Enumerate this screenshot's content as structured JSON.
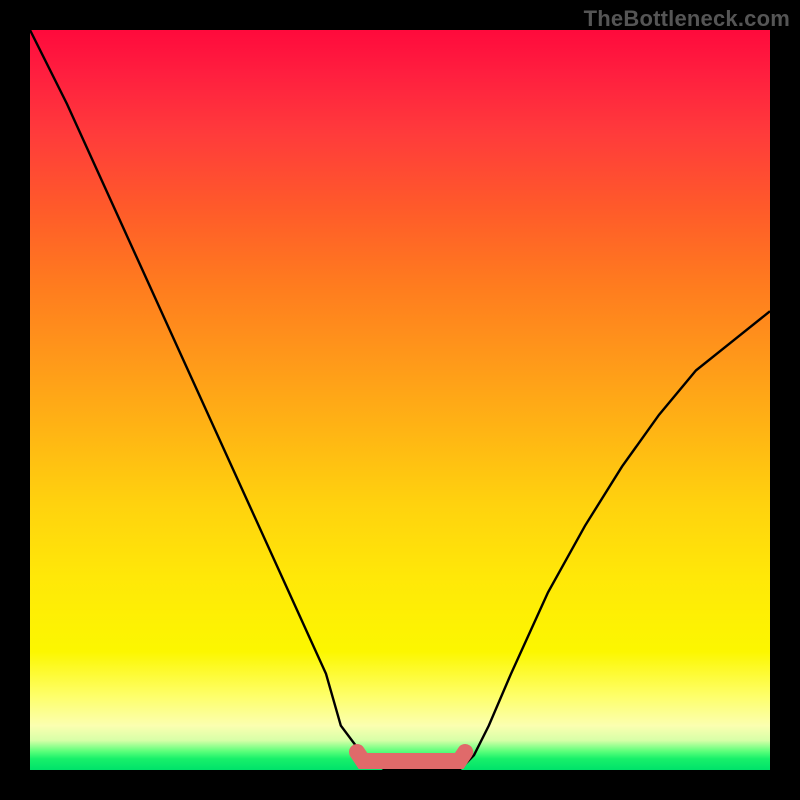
{
  "watermark": "TheBottleneck.com",
  "colors": {
    "frame": "#000000",
    "gradient_top": "#ff0a3c",
    "gradient_mid": "#ffd20e",
    "gradient_bottom": "#00e26a",
    "curve": "#000000",
    "thick_band": "#e06a6a"
  },
  "chart_data": {
    "type": "line",
    "title": "",
    "xlabel": "",
    "ylabel": "",
    "xlim": [
      0,
      100
    ],
    "ylim": [
      0,
      100
    ],
    "x": [
      0,
      5,
      10,
      15,
      20,
      25,
      30,
      35,
      40,
      42,
      45,
      48,
      50,
      53,
      55,
      58,
      60,
      62,
      65,
      70,
      75,
      80,
      85,
      90,
      95,
      100
    ],
    "values": [
      100,
      90,
      79,
      68,
      57,
      46,
      35,
      24,
      13,
      6,
      2,
      0,
      0,
      0,
      0,
      0,
      2,
      6,
      13,
      24,
      33,
      41,
      48,
      54,
      58,
      62
    ],
    "series": [
      {
        "name": "bottleneck_curve",
        "x": [
          0,
          5,
          10,
          15,
          20,
          25,
          30,
          35,
          40,
          42,
          45,
          48,
          50,
          53,
          55,
          58,
          60,
          62,
          65,
          70,
          75,
          80,
          85,
          90,
          95,
          100
        ],
        "y": [
          100,
          90,
          79,
          68,
          57,
          46,
          35,
          24,
          13,
          6,
          2,
          0,
          0,
          0,
          0,
          0,
          2,
          6,
          13,
          24,
          33,
          41,
          48,
          54,
          58,
          62
        ]
      }
    ],
    "flat_min_band_x": [
      45,
      58
    ],
    "grid": false,
    "legend": false
  }
}
